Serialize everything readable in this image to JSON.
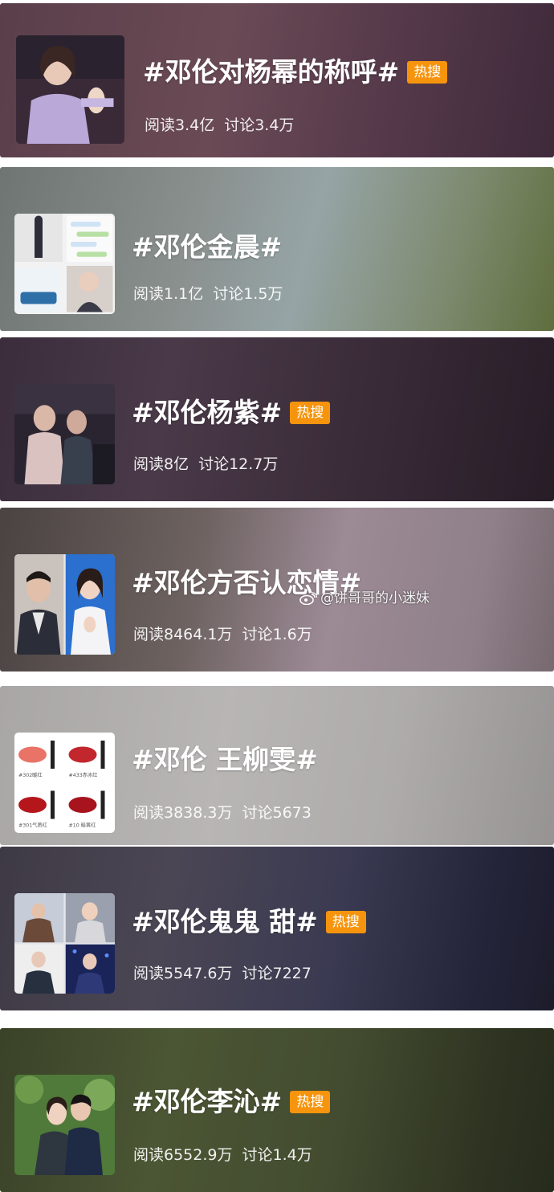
{
  "cards": [
    {
      "title": "#邓伦对杨幂的称呼#",
      "badge": "热搜",
      "reads": "阅读3.4亿",
      "discussions": "讨论3.4万"
    },
    {
      "title": "#邓伦金晨#",
      "badge": "",
      "reads": "阅读1.1亿",
      "discussions": "讨论1.5万"
    },
    {
      "title": "#邓伦杨紫#",
      "badge": "热搜",
      "reads": "阅读8亿",
      "discussions": "讨论12.7万"
    },
    {
      "title": "#邓伦方否认恋情#",
      "badge": "",
      "reads": "阅读8464.1万",
      "discussions": "讨论1.6万"
    },
    {
      "title": "#邓伦 王柳雯#",
      "badge": "",
      "reads": "阅读3838.3万",
      "discussions": "讨论5673"
    },
    {
      "title": "#邓伦鬼鬼 甜#",
      "badge": "热搜",
      "reads": "阅读5547.6万",
      "discussions": "讨论7227"
    },
    {
      "title": "#邓伦李沁#",
      "badge": "热搜",
      "reads": "阅读6552.9万",
      "discussions": "讨论1.4万"
    }
  ],
  "watermark": "@饼哥哥的小迷妹",
  "lipstick_labels": [
    "#302暖红",
    "#433赤冰红",
    "#301气质红",
    "#10 暗黄红"
  ],
  "colors": {
    "badge": "#f7940d",
    "text": "#ffffff"
  }
}
